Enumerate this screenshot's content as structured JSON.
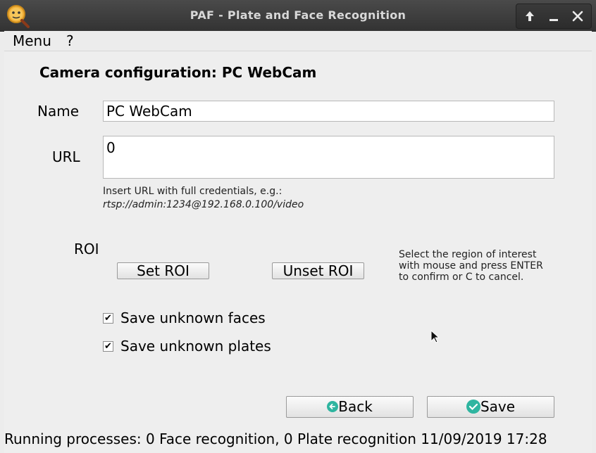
{
  "window": {
    "title": "PAF - Plate and Face Recognition",
    "controls": {
      "maximize": "🡑",
      "minimize": "–",
      "close": "✕"
    }
  },
  "menubar": {
    "menu_label": "Menu",
    "help_label": "?"
  },
  "form": {
    "heading": "Camera configuration: PC WebCam",
    "name_label": "Name",
    "name_value": "PC WebCam",
    "url_label": "URL",
    "url_value": "0",
    "url_hint_line1": "Insert URL with full credentials, e.g.:",
    "url_hint_line2": "rtsp://admin:1234@192.168.0.100/video",
    "roi_label": "ROI",
    "set_roi_label": "Set ROI",
    "unset_roi_label": "Unset ROI",
    "roi_hint_line1": "Select the region of interest",
    "roi_hint_line2": "with mouse and press ENTER",
    "roi_hint_line3": "to confirm or C to cancel.",
    "save_faces_label": "Save unknown faces",
    "save_faces_checked": true,
    "save_plates_label": "Save unknown plates",
    "save_plates_checked": true,
    "back_label": "Back",
    "save_label": "Save"
  },
  "status": {
    "text": "Running processes: 0 Face recognition, 0 Plate recognition 11/09/2019 17:28"
  },
  "colors": {
    "accent": "#2fb5a0",
    "titlebar": "#3c3c3c"
  },
  "icons": {
    "app": "magnifier-face-icon",
    "back": "arrow-left-circle-icon",
    "save": "check-circle-icon"
  }
}
